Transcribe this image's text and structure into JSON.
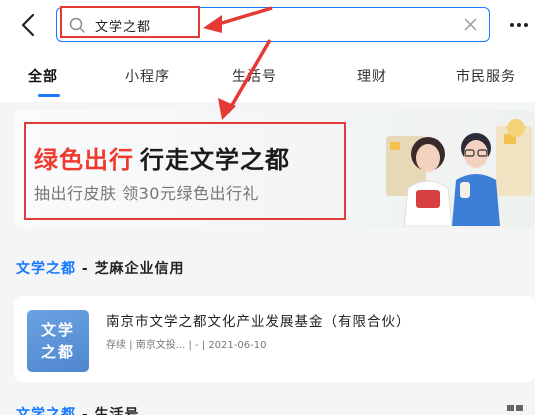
{
  "search": {
    "query": "文学之都"
  },
  "tabs": [
    {
      "label": "全部",
      "active": true
    },
    {
      "label": "小程序",
      "active": false
    },
    {
      "label": "生活号",
      "active": false
    },
    {
      "label": "理财",
      "active": false
    },
    {
      "label": "市民服务",
      "active": false
    }
  ],
  "banner": {
    "title_highlight": "绿色出行",
    "title_main": "行走文学之都",
    "subtitle": "抽出行皮肤 领30元绿色出行礼"
  },
  "section": {
    "keyword": "文学之都",
    "separator": " - ",
    "category": "芝麻企业信用"
  },
  "result": {
    "logo_line1": "文学",
    "logo_line2": "之都",
    "name": "南京市文学之都文化产业发展基金（有限合伙）",
    "meta": "存续 | 南京文投... | - | 2021-06-10"
  },
  "bottom_section": {
    "keyword": "文学之都",
    "rest": "- 生活号"
  },
  "colors": {
    "accent": "#1677ff",
    "highlight_red": "#f03a2f",
    "annotation": "#e53935"
  }
}
